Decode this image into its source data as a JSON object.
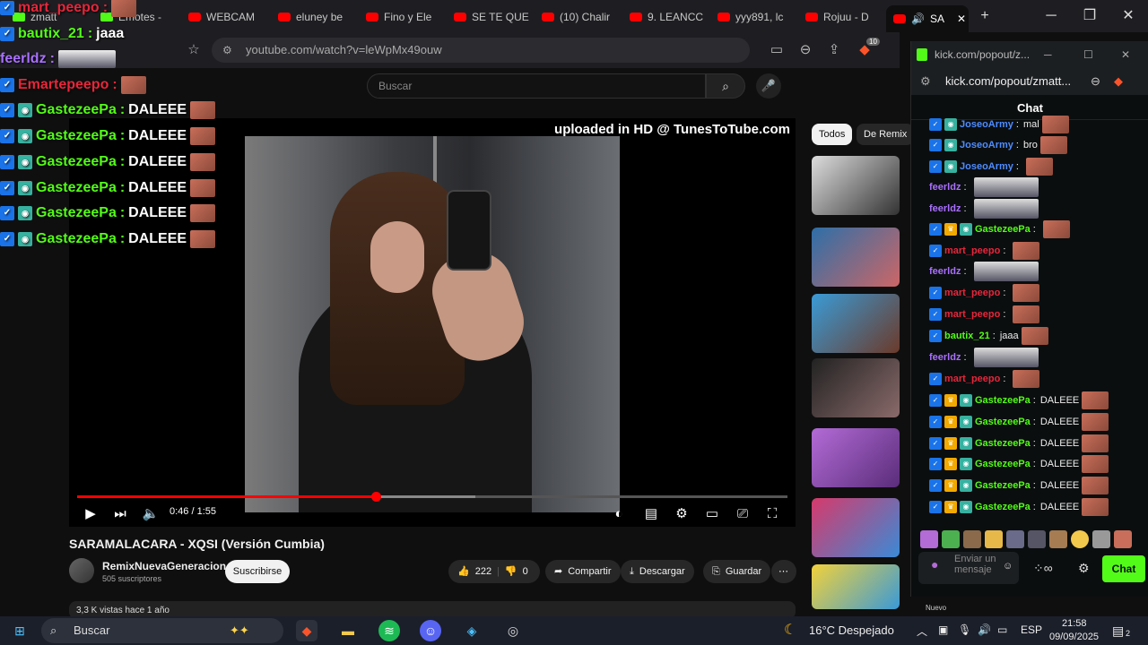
{
  "browser": {
    "tabs": [
      {
        "label": "zmatt",
        "icon": "kick-icon"
      },
      {
        "label": "Emotes -",
        "icon": "kick-icon"
      },
      {
        "label": "WEBCAM",
        "icon": "youtube-icon"
      },
      {
        "label": "eluney be",
        "icon": "youtube-icon"
      },
      {
        "label": "Fino y Ele",
        "icon": "youtube-icon"
      },
      {
        "label": "SE TE QUE",
        "icon": "youtube-icon"
      },
      {
        "label": "(10) Chalir",
        "icon": "youtube-icon"
      },
      {
        "label": "9. LEANCC",
        "icon": "youtube-icon"
      },
      {
        "label": "yyy891, lc",
        "icon": "youtube-icon"
      },
      {
        "label": "Rojuu - D",
        "icon": "youtube-icon"
      },
      {
        "label": "SA",
        "icon": "youtube-icon"
      }
    ],
    "url": "youtube.com/watch?v=leWpMx49ouw",
    "brave_badge": "10"
  },
  "youtube": {
    "search_placeholder": "Buscar",
    "overlay_text": "uploaded in HD @ TunesToTube.com",
    "time": "0:46 / 1:55",
    "progress_fraction": 0.42,
    "buffered_fraction": 0.56,
    "video_title": "SARAMALACARA - XQSI (Versión Cumbia)",
    "channel_name": "RemixNuevaGeneracion",
    "subscribers": "505 suscriptores",
    "subscribe_label": "Suscribirse",
    "likes": "222",
    "dislikes": "0",
    "share_label": "Compartir",
    "download_label": "Descargar",
    "save_label": "Guardar",
    "more_label": "⋯",
    "views_text": "3,3 K vistas  hace 1 año",
    "chips": [
      "Todos",
      "De Remix"
    ],
    "sidebar_badge": "Nuevo"
  },
  "stream_overlay": {
    "lines": [
      {
        "user": "mart_peepo",
        "sep": ":",
        "msg": "",
        "color": "#e8263b"
      },
      {
        "user": "bautix_21",
        "sep": " :",
        "msg": "jaaa",
        "color": "#53fc18"
      },
      {
        "user": "feerldz",
        "sep": " :",
        "msg": "",
        "color": "#a970ff"
      },
      {
        "user": "Emartepeepo",
        "sep": ":",
        "msg": "",
        "color": "#e8263b"
      },
      {
        "user": "GastezeePa",
        "sep": " :",
        "msg": "DALEEE",
        "color": "#53fc18"
      },
      {
        "user": "GastezeePa",
        "sep": " :",
        "msg": "DALEEE",
        "color": "#53fc18"
      },
      {
        "user": "GastezeePa",
        "sep": " :",
        "msg": "DALEEE",
        "color": "#53fc18"
      },
      {
        "user": "GastezeePa",
        "sep": " :",
        "msg": "DALEEE",
        "color": "#53fc18"
      },
      {
        "user": "GastezeePa",
        "sep": " :",
        "msg": "DALEEE",
        "color": "#53fc18"
      },
      {
        "user": "GastezeePa",
        "sep": " :",
        "msg": "DALEEE",
        "color": "#53fc18"
      }
    ]
  },
  "kick": {
    "window_title": "kick.com/popout/z...",
    "url": "kick.com/popout/zmatt...",
    "chat_header": "Chat",
    "messages": [
      {
        "user": "JoseoArmy",
        "sep": ":",
        "msg": "mal",
        "color": "#4f8cff"
      },
      {
        "user": "JoseoArmy",
        "sep": ":",
        "msg": "bro",
        "color": "#4f8cff"
      },
      {
        "user": "JoseoArmy",
        "sep": ":",
        "msg": "",
        "color": "#4f8cff"
      },
      {
        "user": "feerldz",
        "sep": ":",
        "msg": "",
        "color": "#a970ff"
      },
      {
        "user": "feerldz",
        "sep": ":",
        "msg": "",
        "color": "#a970ff"
      },
      {
        "user": "GastezeePa",
        "sep": ":",
        "msg": "",
        "color": "#53fc18"
      },
      {
        "user": "mart_peepo",
        "sep": ":",
        "msg": "",
        "color": "#e8263b"
      },
      {
        "user": "feerldz",
        "sep": ":",
        "msg": "",
        "color": "#a970ff"
      },
      {
        "user": "mart_peepo",
        "sep": ":",
        "msg": "",
        "color": "#e8263b"
      },
      {
        "user": "mart_peepo",
        "sep": ":",
        "msg": "",
        "color": "#e8263b"
      },
      {
        "user": "bautix_21",
        "sep": ":",
        "msg": "jaaa",
        "color": "#53fc18"
      },
      {
        "user": "feerldz",
        "sep": ":",
        "msg": "",
        "color": "#a970ff"
      },
      {
        "user": "mart_peepo",
        "sep": ":",
        "msg": "",
        "color": "#e8263b"
      },
      {
        "user": "GastezeePa",
        "sep": ":",
        "msg": "DALEEE",
        "color": "#53fc18"
      },
      {
        "user": "GastezeePa",
        "sep": ":",
        "msg": "DALEEE",
        "color": "#53fc18"
      },
      {
        "user": "GastezeePa",
        "sep": ":",
        "msg": "DALEEE",
        "color": "#53fc18"
      },
      {
        "user": "GastezeePa",
        "sep": ":",
        "msg": "DALEEE",
        "color": "#53fc18"
      },
      {
        "user": "GastezeePa",
        "sep": ":",
        "msg": "DALEEE",
        "color": "#53fc18"
      },
      {
        "user": "GastezeePa",
        "sep": ":",
        "msg": "DALEEE",
        "color": "#53fc18"
      }
    ],
    "input_placeholder": "Enviar un mensaje",
    "chat_button": "Chat",
    "accent": "#53fc18"
  },
  "taskbar": {
    "search_label": "Buscar",
    "weather": "16°C  Despejado",
    "language": "ESP",
    "time": "21:58",
    "date": "09/09/2025",
    "notifications": "2"
  }
}
